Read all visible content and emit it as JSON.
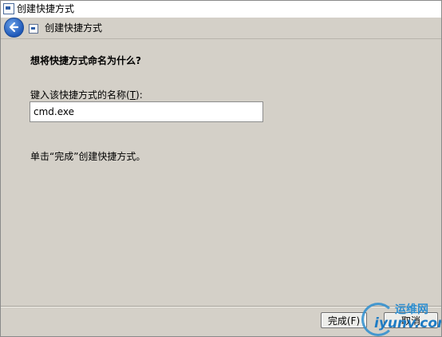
{
  "window": {
    "title": "创建快捷方式"
  },
  "header": {
    "title": "创建快捷方式",
    "back_icon": "back-arrow-icon",
    "page_icon": "shortcut-icon"
  },
  "main": {
    "question": "想将快捷方式命名为什么?",
    "field_label_prefix": "键入该快捷方式的名称(",
    "field_label_hotkey": "T",
    "field_label_suffix": "):",
    "name_value": "cmd.exe",
    "hint": "单击“完成”创建快捷方式。"
  },
  "buttons": {
    "finish_label": "完成(F)",
    "cancel_label": "取消"
  },
  "watermark": {
    "cn": "运维网",
    "en": "iyunv.com"
  },
  "colors": {
    "dialog_bg": "#d4d0c8",
    "accent": "#2d8ed0"
  }
}
